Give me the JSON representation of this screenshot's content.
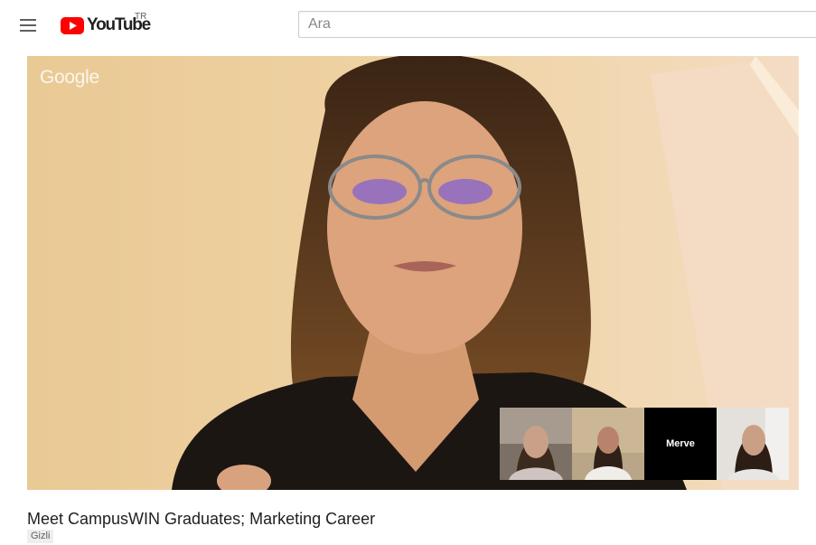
{
  "header": {
    "logo_text": "YouTube",
    "country_code": "TR",
    "search_placeholder": "Ara"
  },
  "player": {
    "watermark": "Google",
    "participants": [
      {
        "name": ""
      },
      {
        "name": ""
      },
      {
        "name": "Merve"
      },
      {
        "name": ""
      }
    ]
  },
  "video": {
    "title": "Meet CampusWIN Graduates; Marketing Career",
    "privacy_badge": "Gizli"
  },
  "colors": {
    "brand_red": "#ff0000",
    "background": "#ffffff"
  }
}
